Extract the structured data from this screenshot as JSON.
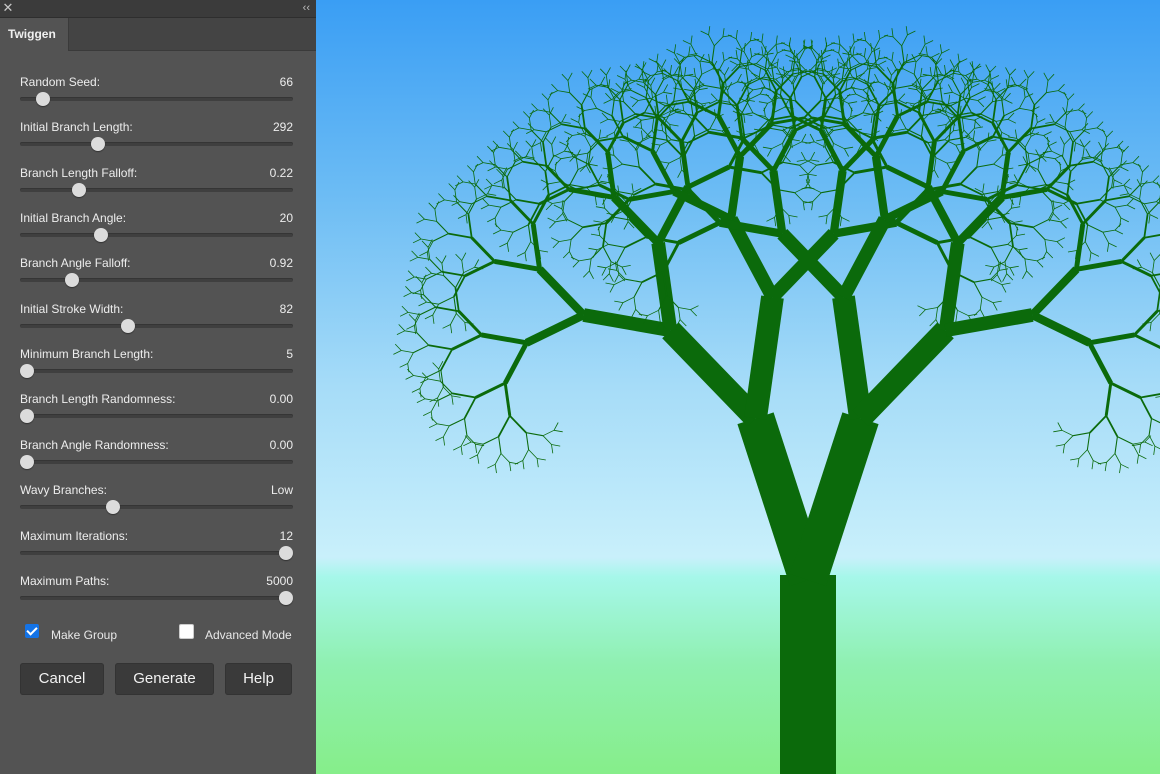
{
  "panel": {
    "tab_label": "Twiggen",
    "close_glyph": "✕",
    "collapse_glyph": "‹‹",
    "sliders": [
      {
        "label": "Random Seed:",
        "value": "66",
        "position": 0.085
      },
      {
        "label": "Initial Branch Length:",
        "value": "292",
        "position": 0.285
      },
      {
        "label": "Branch Length Falloff:",
        "value": "0.22",
        "position": 0.215
      },
      {
        "label": "Initial Branch Angle:",
        "value": "20",
        "position": 0.295
      },
      {
        "label": "Branch Angle Falloff:",
        "value": "0.92",
        "position": 0.19
      },
      {
        "label": "Initial Stroke Width:",
        "value": "82",
        "position": 0.395
      },
      {
        "label": "Minimum Branch Length:",
        "value": "5",
        "position": 0.025
      },
      {
        "label": "Branch Length Randomness:",
        "value": "0.00",
        "position": 0.025
      },
      {
        "label": "Branch Angle Randomness:",
        "value": "0.00",
        "position": 0.025
      },
      {
        "label": "Wavy Branches:",
        "value": "Low",
        "position": 0.34
      },
      {
        "label": "Maximum Iterations:",
        "value": "12",
        "position": 0.975
      },
      {
        "label": "Maximum Paths:",
        "value": "5000",
        "position": 0.975
      }
    ],
    "make_group": {
      "label": "Make Group",
      "checked": true
    },
    "advanced_mode": {
      "label": "Advanced Mode",
      "checked": false
    },
    "buttons": {
      "cancel": "Cancel",
      "generate": "Generate",
      "help": "Help"
    }
  },
  "colors": {
    "panel_bg": "#535353",
    "accent": "#1473e6",
    "tree_green": "#0b6a0b"
  },
  "canvas": {
    "subject": "fractal tree"
  }
}
